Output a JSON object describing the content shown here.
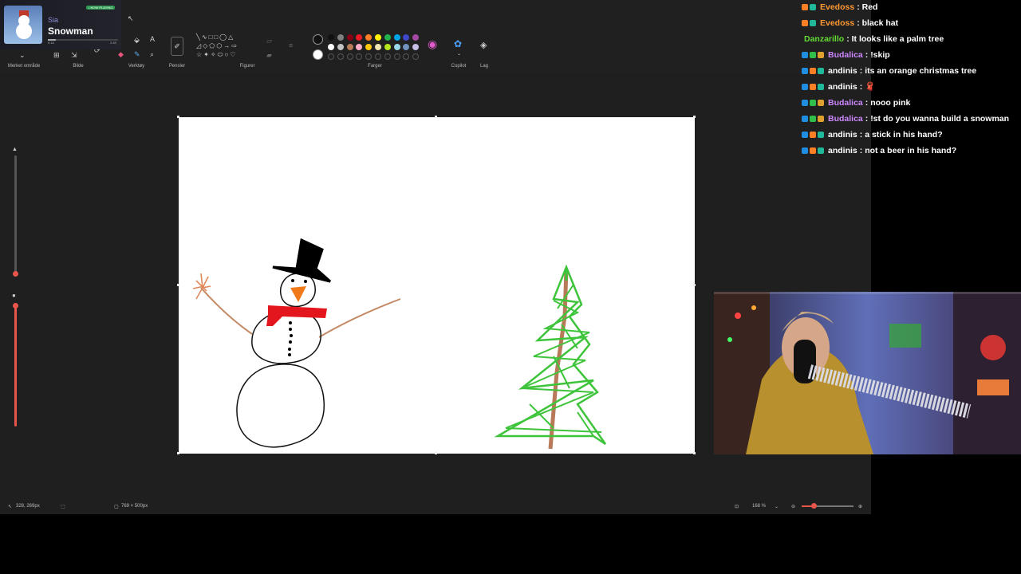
{
  "now_playing": {
    "badge": "• NOW PLAYING",
    "artist": "Sia",
    "title": "Snowman",
    "elapsed": "0:18",
    "duration": "2:45",
    "progress": 0.11
  },
  "toolbar": {
    "groups": [
      "Merket område",
      "Bilde",
      "Verktøy",
      "Pensler",
      "Figurer",
      "Farger",
      "Copilot",
      "Lag"
    ],
    "colors_row1": [
      "#111111",
      "#7f7f7f",
      "#880015",
      "#ed1c24",
      "#ff7f27",
      "#fff200",
      "#22b14c",
      "#00a2e8",
      "#3f48cc",
      "#a349a4"
    ],
    "colors_row2": [
      "#ffffff",
      "#c3c3c3",
      "#b97a57",
      "#ffaec9",
      "#ffc90e",
      "#efe4b0",
      "#b5e61d",
      "#99d9ea",
      "#7092be",
      "#c8bfe7"
    ],
    "primary_color": "#111111",
    "secondary_color": "#ffffff"
  },
  "statusbar": {
    "cursor_position": "328, 269px",
    "canvas_size": "769 × 500px",
    "zoom_level": "168 %"
  },
  "chat": {
    "messages": [
      {
        "user": "Evedoss",
        "color": "#ff9933",
        "badges": [
          "#ff7f27",
          "#1fb89a"
        ],
        "text": "Red"
      },
      {
        "user": "Evedoss",
        "color": "#ff9933",
        "badges": [
          "#ff7f27",
          "#1fb89a"
        ],
        "text": "black hat"
      },
      {
        "user": "Danzarillo",
        "color": "#66dd33",
        "badges": [],
        "text": "It looks like a palm tree"
      },
      {
        "user": "Budalica",
        "color": "#cc88ff",
        "badges": [
          "#1f8ee0",
          "#2fbf4a",
          "#e0a030"
        ],
        "text": "!skip"
      },
      {
        "user": "andinis",
        "color": "#ffffff",
        "badges": [
          "#1f8ee0",
          "#ff7f27",
          "#1fb89a"
        ],
        "text": "its an orange christmas tree"
      },
      {
        "user": "andinis",
        "color": "#ffffff",
        "badges": [
          "#1f8ee0",
          "#ff7f27",
          "#1fb89a"
        ],
        "text": ""
      },
      {
        "user": "Budalica",
        "color": "#cc88ff",
        "badges": [
          "#1f8ee0",
          "#2fbf4a",
          "#e0a030"
        ],
        "text": "nooo pink"
      },
      {
        "user": "Budalica",
        "color": "#cc88ff",
        "badges": [
          "#1f8ee0",
          "#2fbf4a",
          "#e0a030"
        ],
        "text": "!st do you wanna build a snowman"
      },
      {
        "user": "andinis",
        "color": "#ffffff",
        "badges": [
          "#1f8ee0",
          "#ff7f27",
          "#1fb89a"
        ],
        "text": "a stick in his hand?"
      },
      {
        "user": "andinis",
        "color": "#ffffff",
        "badges": [
          "#1f8ee0",
          "#ff7f27",
          "#1fb89a"
        ],
        "text": "not a beer in his hand?"
      }
    ]
  },
  "drawing": {
    "snowman_hat_color": "#000000",
    "snowman_nose_color": "#f07a1a",
    "scarf_color": "#e4161d",
    "arm_color": "#c48a66",
    "tree_color": "#3ec43a",
    "trunk_color": "#b87a58"
  }
}
